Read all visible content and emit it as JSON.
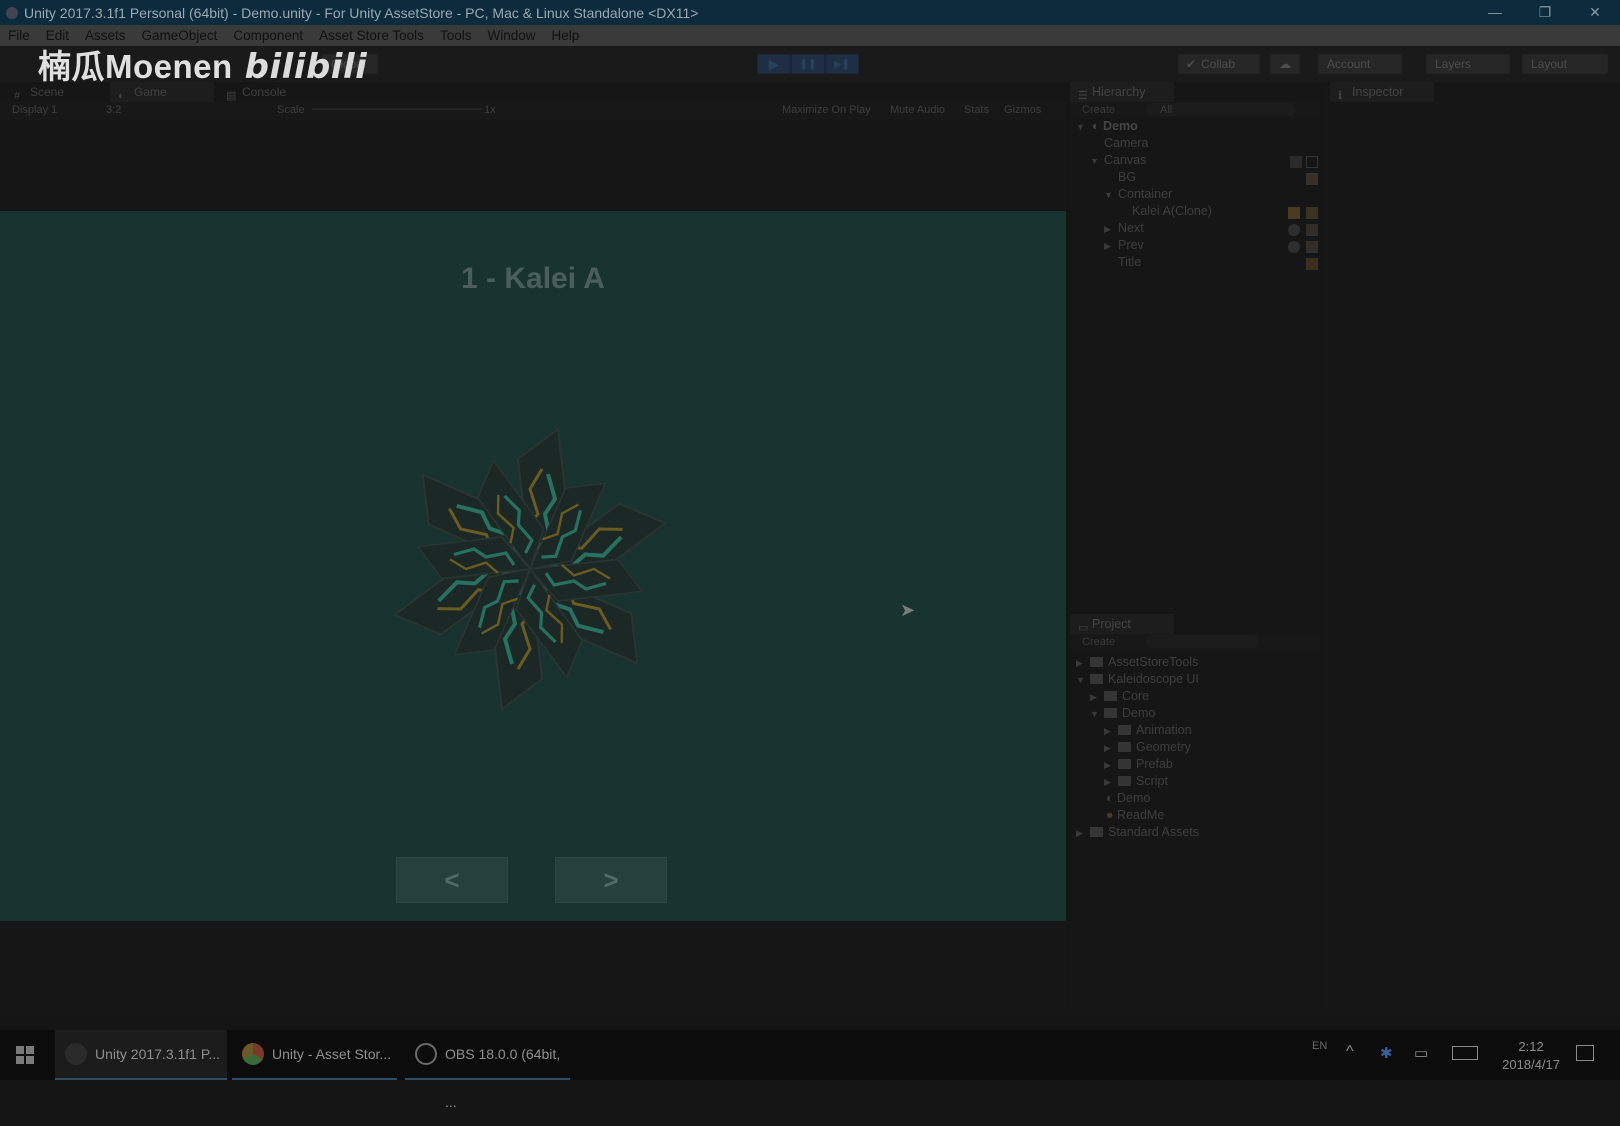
{
  "window": {
    "title": "Unity 2017.3.1f1 Personal (64bit) - Demo.unity - For Unity AssetStore - PC, Mac & Linux Standalone <DX11>",
    "minimize": "—",
    "restore": "❐",
    "close": "✕"
  },
  "menu": [
    "File",
    "Edit",
    "Assets",
    "GameObject",
    "Component",
    "Asset Store Tools",
    "Tools",
    "Window",
    "Help"
  ],
  "watermark": {
    "text": "楠瓜Moenen",
    "logo": "bilibili"
  },
  "toolbar": {
    "global": "Global",
    "collab": "Collab",
    "account": "Account",
    "layers": "Layers",
    "layout": "Layout",
    "play_icon": "▶",
    "pause_icon": "❚❚",
    "step_icon": "▶❚"
  },
  "game_panel": {
    "tabs": [
      "Scene",
      "Game",
      "Console"
    ],
    "display": "Display 1",
    "aspect": "3:2",
    "scale_label": "Scale",
    "scale_value": "1x",
    "options": [
      "Maximize On Play",
      "Mute Audio",
      "Stats",
      "Gizmos"
    ]
  },
  "game_view": {
    "title": "1 - Kalei A",
    "prev_label": "<",
    "next_label": ">"
  },
  "hierarchy": {
    "tab": "Hierarchy",
    "create": "Create",
    "search": "All",
    "scene": "Demo",
    "items": [
      "Camera",
      "Canvas",
      "BG",
      "Container",
      "Kalei A(Clone)",
      "Next",
      "Prev",
      "Title"
    ]
  },
  "inspector": {
    "tab": "Inspector"
  },
  "project": {
    "tab": "Project",
    "create": "Create",
    "items": [
      "AssetStoreTools",
      "Kaleidoscope UI",
      "Core",
      "Demo",
      "Animation",
      "Geometry",
      "Prefab",
      "Script",
      "Demo",
      "ReadMe",
      "Standard Assets"
    ]
  },
  "taskbar": {
    "apps": [
      "Unity 2017.3.1f1 P...",
      "Unity - Asset Stor...",
      "OBS 18.0.0 (64bit, ..."
    ],
    "lang": "EN",
    "time": "2:12",
    "date": "2018/4/17"
  }
}
